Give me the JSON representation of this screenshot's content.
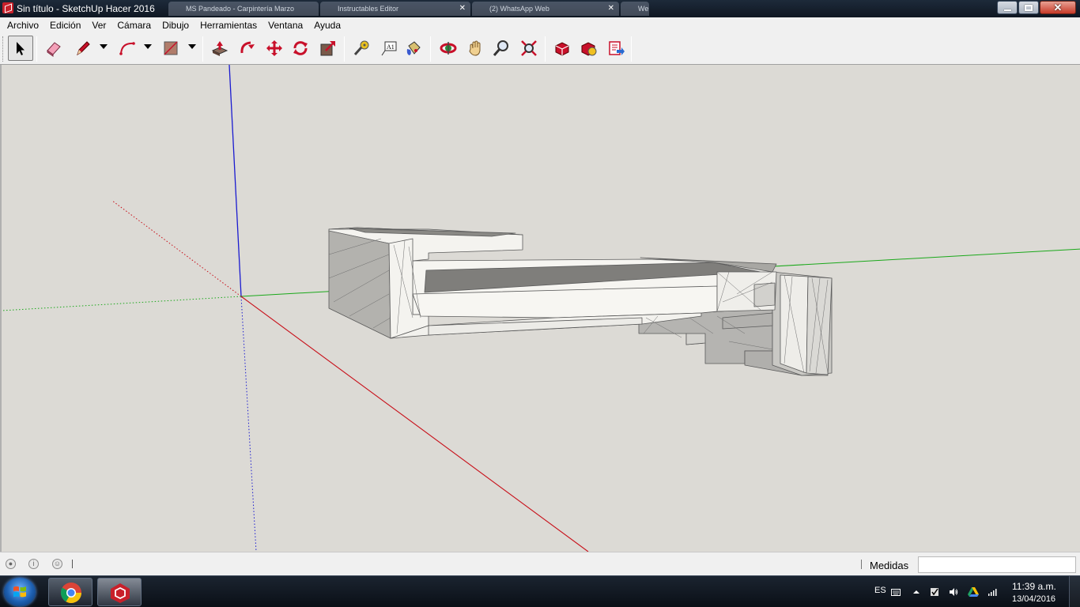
{
  "window": {
    "title": "Sin título - SketchUp Hacer 2016",
    "background_tabs": [
      "MS Pandeado - Carpintería Marzo",
      "Instructables Editor",
      "(2) WhatsApp Web",
      "Web"
    ]
  },
  "menu": {
    "items": [
      "Archivo",
      "Edición",
      "Ver",
      "Cámara",
      "Dibujo",
      "Herramientas",
      "Ventana",
      "Ayuda"
    ]
  },
  "toolbar": {
    "tools": [
      {
        "name": "select-tool",
        "icon": "arrow-cursor-icon",
        "active": true
      },
      {
        "name": "eraser-tool",
        "icon": "eraser-icon"
      },
      {
        "name": "pencil-tool",
        "icon": "pencil-icon",
        "dropdown": true
      },
      {
        "name": "arc-tool",
        "icon": "arc-icon",
        "dropdown": true
      },
      {
        "name": "rectangle-tool",
        "icon": "rectangle-icon",
        "dropdown": true
      },
      {
        "name": "push-pull-tool",
        "icon": "push-pull-icon"
      },
      {
        "name": "follow-me-tool",
        "icon": "follow-me-icon"
      },
      {
        "name": "move-tool",
        "icon": "move-icon"
      },
      {
        "name": "rotate-tool",
        "icon": "rotate-icon"
      },
      {
        "name": "scale-tool",
        "icon": "scale-icon"
      },
      {
        "name": "tape-measure-tool",
        "icon": "tape-measure-icon"
      },
      {
        "name": "text-tool",
        "icon": "text-icon",
        "glyph": "A1"
      },
      {
        "name": "paint-bucket-tool",
        "icon": "paint-bucket-icon"
      },
      {
        "name": "orbit-tool",
        "icon": "orbit-icon"
      },
      {
        "name": "pan-tool",
        "icon": "hand-icon"
      },
      {
        "name": "zoom-tool",
        "icon": "magnifier-icon"
      },
      {
        "name": "zoom-extents-tool",
        "icon": "zoom-extents-icon"
      },
      {
        "name": "warehouse-tool",
        "icon": "3d-warehouse-icon"
      },
      {
        "name": "extension-warehouse-tool",
        "icon": "extension-warehouse-icon"
      },
      {
        "name": "send-to-layout-tool",
        "icon": "send-to-layout-icon"
      }
    ]
  },
  "status": {
    "measure_label": "Medidas",
    "measure_value": ""
  },
  "taskbar": {
    "language": "ES",
    "time": "11:39 a.m.",
    "date": "13/04/2016"
  },
  "colors": {
    "axis_red": "#c8101a",
    "axis_green": "#1aa81a",
    "axis_blue": "#1a1ad0",
    "viewport_bg": "#dcdad5",
    "model_face": "#f4f3ef",
    "model_shadow": "#a9a8a5"
  }
}
